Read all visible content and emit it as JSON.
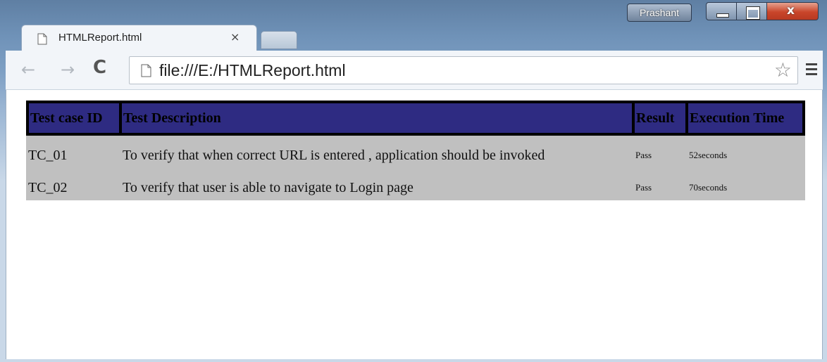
{
  "window": {
    "user_label": "Prashant",
    "controls": {
      "minimize": "",
      "maximize": "",
      "close": "x"
    }
  },
  "tab": {
    "title": "HTMLReport.html",
    "close": "×"
  },
  "toolbar": {
    "url": "file:///E:/HTMLReport.html",
    "back": "←",
    "forward": "→",
    "reload": "C",
    "star": "☆"
  },
  "report": {
    "headers": [
      "Test case ID",
      "Test Description",
      "Result",
      "Execution Time"
    ],
    "rows": [
      {
        "id": "TC_01",
        "description": "To verify that when correct URL is entered , application should be invoked",
        "result": "Pass",
        "time": "52seconds"
      },
      {
        "id": "TC_02",
        "description": "To verify that user is able to navigate to Login page",
        "result": "Pass",
        "time": "70seconds"
      }
    ],
    "colors": {
      "header_bg": "#2e2b82",
      "row_bg": "#c0c0c0"
    }
  },
  "icons": [
    "page-icon",
    "star-icon",
    "menu-icon",
    "back-icon",
    "forward-icon",
    "reload-icon"
  ]
}
